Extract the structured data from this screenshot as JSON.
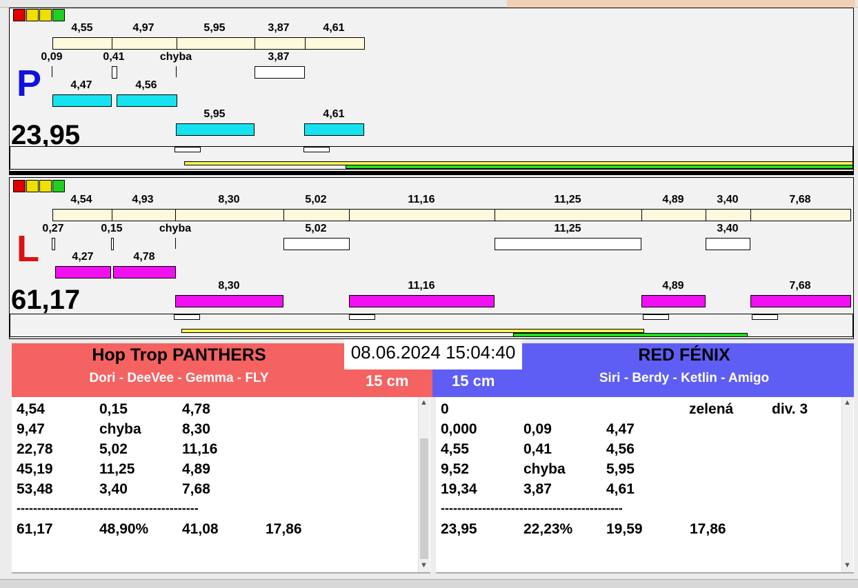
{
  "top_panel": {
    "letter": "P",
    "letter_color": "#1010e0",
    "total": "23,95",
    "row1": [
      "4,55",
      "4,97",
      "5,95",
      "3,87",
      "4,61"
    ],
    "row2": [
      "0,09",
      "0,41",
      "chyba",
      "3,87"
    ],
    "row3": [
      "4,47",
      "4,56"
    ],
    "row4": [
      "5,95",
      "4,61"
    ]
  },
  "bottom_panel": {
    "letter": "L",
    "letter_color": "#e01010",
    "total": "61,17",
    "row1": [
      "4,54",
      "4,93",
      "8,30",
      "5,02",
      "11,16",
      "11,25",
      "4,89",
      "3,40",
      "7,68"
    ],
    "row2": [
      "0,27",
      "0,15",
      "chyba",
      "5,02",
      "11,25",
      "3,40"
    ],
    "row3": [
      "4,27",
      "4,78"
    ],
    "row4": [
      "8,30",
      "11,16",
      "4,89",
      "7,68"
    ]
  },
  "datetime": "08.06.2024 15:04:40",
  "left_team": {
    "name": "Hop Trop PANTHERS",
    "members": "Dori - DeeVee - Gemma - FLY",
    "height": "15 cm",
    "color": "#f46262"
  },
  "right_team": {
    "name": "RED FÉNIX",
    "members": "Siri - Berdy - Ketlin - Amigo",
    "height": "15 cm",
    "color": "#5e5ef5"
  },
  "left_table": {
    "rows": [
      [
        "4,54",
        "0,15",
        "4,78"
      ],
      [
        "9,47",
        "chyba",
        "8,30"
      ],
      [
        "22,78",
        "5,02",
        "11,16"
      ],
      [
        "45,19",
        "11,25",
        "4,89"
      ],
      [
        "53,48",
        "3,40",
        "7,68"
      ]
    ],
    "separator": "--------------------------------------------",
    "summary": [
      "61,17",
      "48,90%",
      "41,08",
      "17,86"
    ]
  },
  "right_table": {
    "header": [
      "0",
      "zelená",
      "div. 3"
    ],
    "rows": [
      [
        "0,000",
        "0,09",
        "4,47"
      ],
      [
        "4,55",
        "0,41",
        "4,56"
      ],
      [
        "9,52",
        "chyba",
        "5,95"
      ],
      [
        "19,34",
        "3,87",
        "4,61"
      ]
    ],
    "separator": "--------------------------------------------",
    "summary": [
      "23,95",
      "22,23%",
      "19,59",
      "17,86"
    ]
  },
  "colors": {
    "cream": "#fdf9dc",
    "cyan": "#17e3f0",
    "magenta": "#f010f0",
    "yellow": "#f8f050",
    "green": "#22dd22"
  }
}
